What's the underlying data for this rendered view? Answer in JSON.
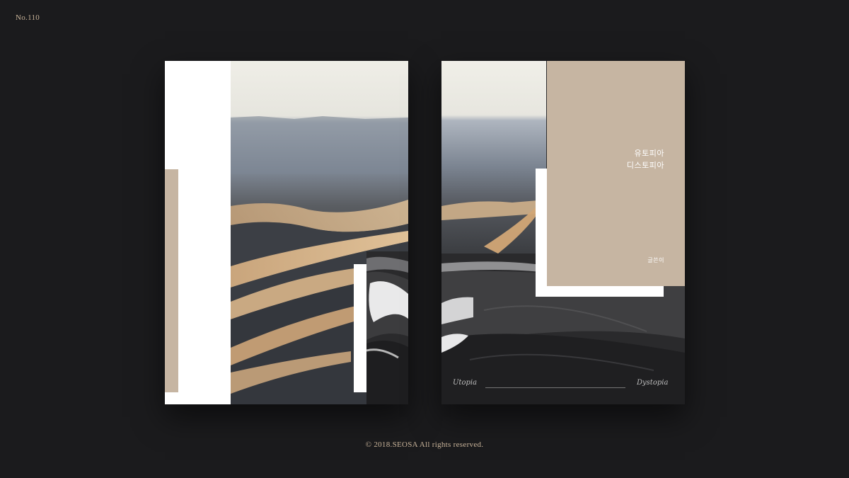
{
  "serial": "No.110",
  "footer": "© 2018.SEOSA All rights reserved.",
  "cover": {
    "title_line1": "유토피아",
    "title_line2": "디스토피아",
    "author": "글쓴이",
    "script_left": "Utopia",
    "script_right": "Dystopia"
  },
  "colors": {
    "background": "#1b1b1d",
    "beige": "#c6b5a2",
    "text_gold": "#c9b49a"
  }
}
